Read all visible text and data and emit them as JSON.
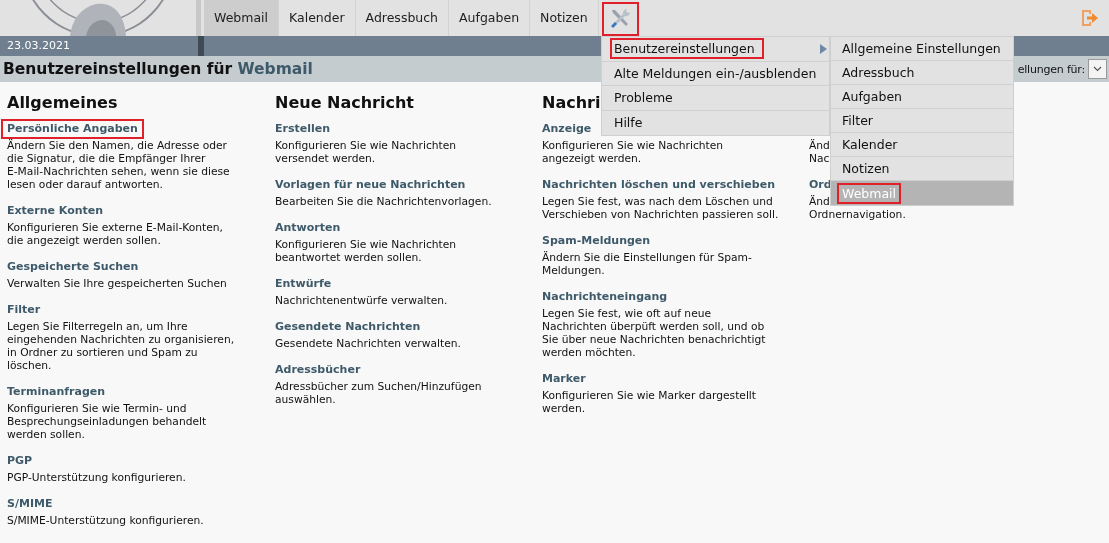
{
  "header": {
    "tabs": [
      {
        "label": "Webmail",
        "selected": true
      },
      {
        "label": "Kalender",
        "selected": false
      },
      {
        "label": "Adressbuch",
        "selected": false
      },
      {
        "label": "Aufgaben",
        "selected": false
      },
      {
        "label": "Notizen",
        "selected": false
      }
    ],
    "tools_button": {
      "highlighted": true
    },
    "date": "23.03.2021"
  },
  "title": {
    "text": "Benutzereinstellungen für",
    "app": "Webmail",
    "settings_for": "ellungen für:"
  },
  "columns": [
    {
      "heading": "Allgemeines",
      "items": [
        {
          "title": "Persönliche Angaben",
          "highlighted": true,
          "description": "Ändern Sie den Namen, die Adresse oder\ndie Signatur, die die Empfänger Ihrer\nE-Mail-Nachrichten sehen, wenn sie diese\nlesen oder darauf antworten."
        },
        {
          "title": "Externe Konten",
          "highlighted": false,
          "description": "Konfigurieren Sie externe E-Mail-Konten,\ndie angezeigt werden sollen."
        },
        {
          "title": "Gespeicherte Suchen",
          "highlighted": false,
          "description": "Verwalten Sie Ihre gespeicherten Suchen"
        },
        {
          "title": "Filter",
          "highlighted": false,
          "description": "Legen Sie Filterregeln an, um Ihre\neingehenden Nachrichten zu organisieren,\nin Ordner zu sortieren und Spam zu\nlöschen."
        },
        {
          "title": "Terminanfragen",
          "highlighted": false,
          "description": "Konfigurieren Sie wie Termin- und\nBesprechungseinladungen behandelt\nwerden sollen."
        },
        {
          "title": "PGP",
          "highlighted": false,
          "description": "PGP-Unterstützung konfigurieren."
        },
        {
          "title": "S/MIME",
          "highlighted": false,
          "description": "S/MIME-Unterstützung konfigurieren."
        }
      ]
    },
    {
      "heading": "Neue Nachricht",
      "items": [
        {
          "title": "Erstellen",
          "highlighted": false,
          "description": "Konfigurieren Sie wie Nachrichten\nversendet werden."
        },
        {
          "title": "Vorlagen für neue Nachrichten",
          "highlighted": false,
          "description": "Bearbeiten Sie die Nachrichtenvorlagen."
        },
        {
          "title": "Antworten",
          "highlighted": false,
          "description": "Konfigurieren Sie wie Nachrichten\nbeantwortet werden sollen."
        },
        {
          "title": "Entwürfe",
          "highlighted": false,
          "description": "Nachrichtenentwürfe verwalten."
        },
        {
          "title": "Gesendete Nachrichten",
          "highlighted": false,
          "description": "Gesendete Nachrichten verwalten."
        },
        {
          "title": "Adressbücher",
          "highlighted": false,
          "description": "Adressbücher zum Suchen/Hinzufügen\nauswählen."
        }
      ]
    },
    {
      "heading": "Nachri",
      "items": [
        {
          "title": "Anzeige",
          "highlighted": false,
          "description": "Konfigurieren Sie wie Nachrichten\nangezeigt werden."
        },
        {
          "title": "Nachrichten löschen und verschieben",
          "highlighted": false,
          "description": "Legen Sie fest, was nach dem Löschen und\nVerschieben von Nachrichten passieren soll."
        },
        {
          "title": "Spam-Meldungen",
          "highlighted": false,
          "description": "Ändern Sie die Einstellungen für Spam-\nMeldungen."
        },
        {
          "title": "Nachrichteneingang",
          "highlighted": false,
          "description": "Legen Sie fest, wie oft auf neue\nNachrichten überpüft werden soll, und ob\nSie über neue Nachrichten benachrichtigt\nwerden möchten."
        },
        {
          "title": "Marker",
          "highlighted": false,
          "description": "Konfigurieren Sie wie Marker dargestellt\nwerden."
        }
      ]
    },
    {
      "items": [
        {
          "description": "Änd\nNac"
        },
        {
          "title": "Ord",
          "highlighted": false,
          "description": "Änd\nOrdnernavigation."
        }
      ]
    }
  ],
  "menu": {
    "items": [
      {
        "label": "Benutzereinstellungen",
        "highlighted": true,
        "has_submenu": true
      },
      {
        "label": "Alte Meldungen ein-/ausblenden",
        "highlighted": false,
        "has_submenu": false
      },
      {
        "label": "Probleme",
        "highlighted": false,
        "has_submenu": false
      },
      {
        "label": "Hilfe",
        "highlighted": false,
        "has_submenu": false
      }
    ]
  },
  "submenu": {
    "items": [
      {
        "label": "Allgemeine Einstellungen",
        "selected": false,
        "highlighted": false
      },
      {
        "label": "Adressbuch",
        "selected": false,
        "highlighted": false
      },
      {
        "label": "Aufgaben",
        "selected": false,
        "highlighted": false
      },
      {
        "label": "Filter",
        "selected": false,
        "highlighted": false
      },
      {
        "label": "Kalender",
        "selected": false,
        "highlighted": false
      },
      {
        "label": "Notizen",
        "selected": false,
        "highlighted": false
      },
      {
        "label": "Webmail",
        "selected": true,
        "highlighted": true
      }
    ]
  }
}
